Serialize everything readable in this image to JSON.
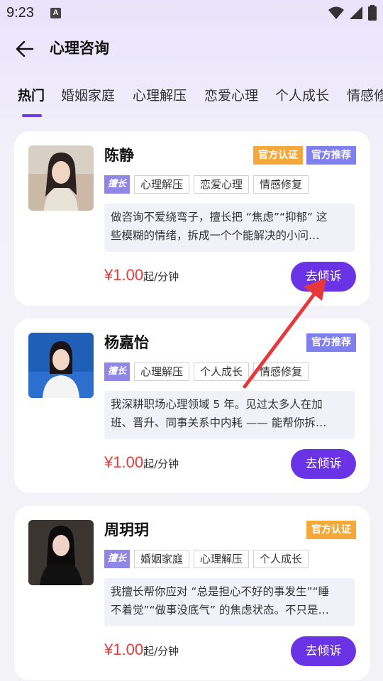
{
  "status_bar": {
    "time": "9:23",
    "notification_icon": "A",
    "icons": [
      "wifi-icon",
      "signal-icon",
      "battery-icon"
    ]
  },
  "header": {
    "back_icon": "arrow-left-icon",
    "title": "心理咨询"
  },
  "tabs": [
    {
      "label": "热门",
      "active": true
    },
    {
      "label": "婚姻家庭",
      "active": false
    },
    {
      "label": "心理解压",
      "active": false
    },
    {
      "label": "恋爱心理",
      "active": false
    },
    {
      "label": "个人成长",
      "active": false
    },
    {
      "label": "情感修",
      "active": false
    }
  ],
  "counselors": [
    {
      "name": "陈静",
      "badges": [
        {
          "label": "官方认证",
          "type": "cert"
        },
        {
          "label": "官方推荐",
          "type": "rec"
        }
      ],
      "specialty_icon": "擅长",
      "tags": [
        "心理解压",
        "恋爱心理",
        "情感修复"
      ],
      "description": [
        "做咨询不爱绕弯子，擅长把 “焦虑”“抑郁” 这",
        "些模糊的情绪，拆成一个个能解决的小问…"
      ],
      "price": "¥1.00",
      "price_unit": "起/分钟",
      "button_label": "去倾诉"
    },
    {
      "name": "杨嘉怡",
      "badges": [
        {
          "label": "官方推荐",
          "type": "rec"
        }
      ],
      "specialty_icon": "擅长",
      "tags": [
        "心理解压",
        "个人成长",
        "情感修复"
      ],
      "description": [
        "我深耕职场心理领域 5 年。见过太多人在加",
        "班、晋升、同事关系中内耗 —— 能帮你拆…"
      ],
      "price": "¥1.00",
      "price_unit": "起/分钟",
      "button_label": "去倾诉"
    },
    {
      "name": "周玥玥",
      "badges": [
        {
          "label": "官方认证",
          "type": "cert"
        }
      ],
      "specialty_icon": "擅长",
      "tags": [
        "婚姻家庭",
        "心理解压",
        "个人成长"
      ],
      "description": [
        "我擅长帮你应对 “总是担心不好的事发生”“睡",
        "不着觉”“做事没底气” 的焦虑状态。不只是…"
      ],
      "price": "¥1.00",
      "price_unit": "起/分钟",
      "button_label": "去倾诉"
    }
  ],
  "colors": {
    "accent": "#6a34e6",
    "price": "#e83a3a",
    "badge_cert": "#f5a83a",
    "badge_rec": "#7f7ff0",
    "annotation_arrow": "#e8373a"
  }
}
